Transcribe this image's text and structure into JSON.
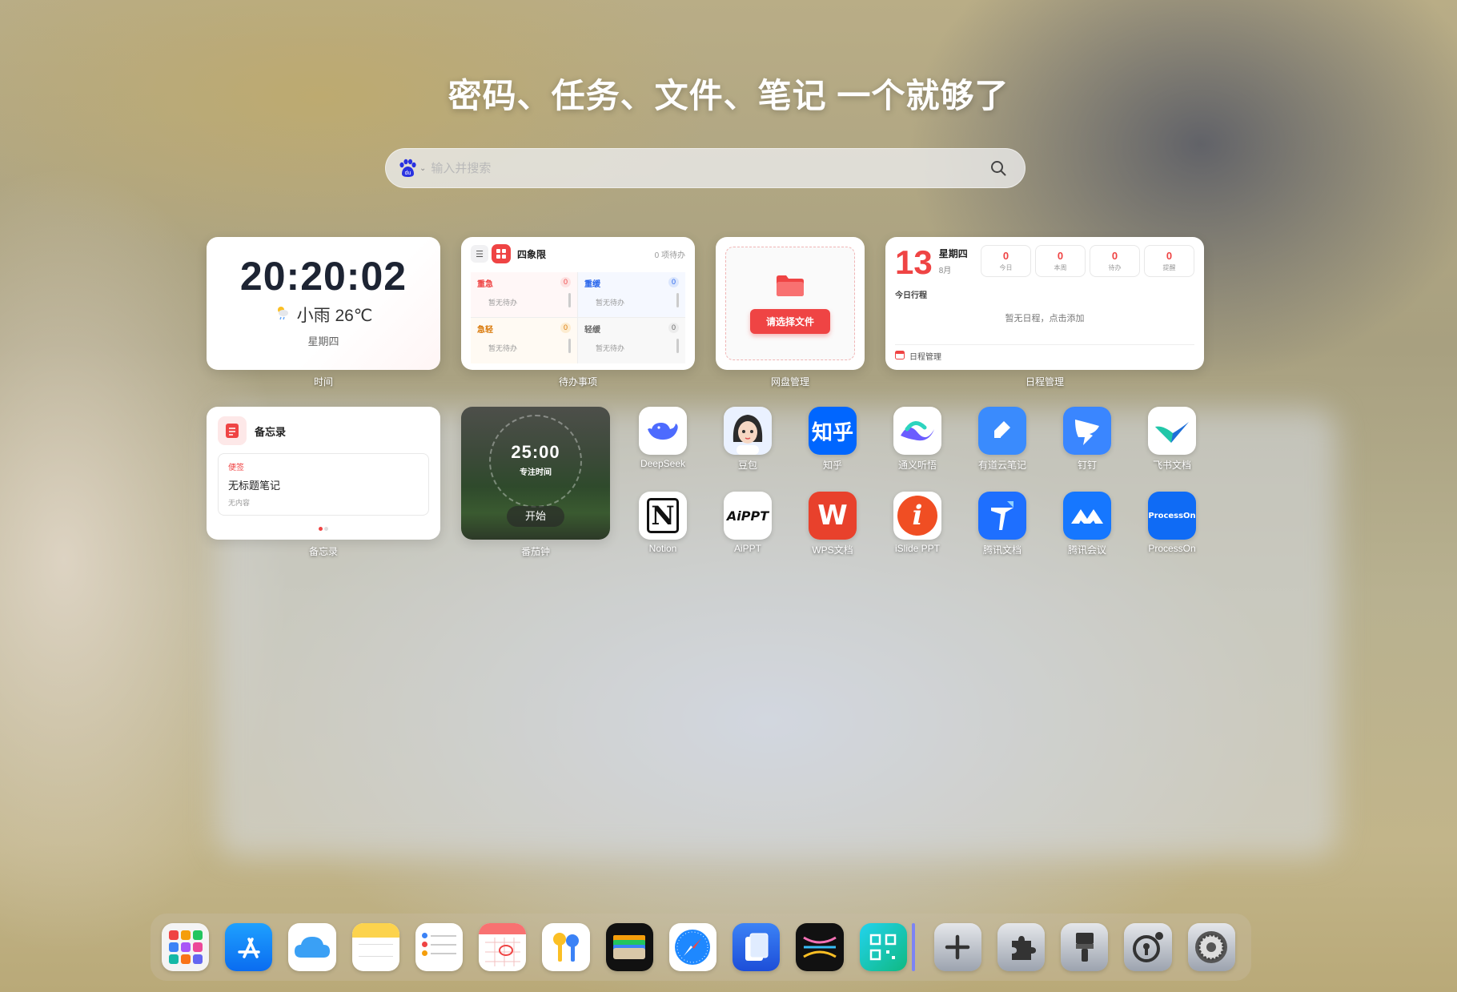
{
  "headline": "密码、任务、文件、笔记 一个就够了",
  "search": {
    "placeholder": "输入并搜索",
    "engine_icon": "baidu-paw-icon",
    "du": "du"
  },
  "widgets": {
    "time": {
      "clock": "20:20:02",
      "weather": "小雨 26℃",
      "weekday": "星期四",
      "caption": "时间"
    },
    "todo": {
      "title": "四象限",
      "count": "0 项待办",
      "caption": "待办事项",
      "quadrants": [
        {
          "label": "重急",
          "count": "0",
          "empty": "暂无待办",
          "color": "#ef4444",
          "badge_bg": "#fde2e2",
          "bg": "#fff7f7"
        },
        {
          "label": "重缓",
          "count": "0",
          "empty": "暂无待办",
          "color": "#2563eb",
          "badge_bg": "#dbe6fd",
          "bg": "#f5f8ff"
        },
        {
          "label": "急轻",
          "count": "0",
          "empty": "暂无待办",
          "color": "#d97706",
          "badge_bg": "#fdecd0",
          "bg": "#fffaf3"
        },
        {
          "label": "轻缓",
          "count": "0",
          "empty": "暂无待办",
          "color": "#666666",
          "badge_bg": "#ececec",
          "bg": "#f8f8f8"
        }
      ]
    },
    "disk": {
      "button": "请选择文件",
      "caption": "网盘管理"
    },
    "schedule": {
      "day": "13",
      "weekday": "星期四",
      "month": "8月",
      "stats": [
        {
          "value": "0",
          "label": "今日"
        },
        {
          "value": "0",
          "label": "本周"
        },
        {
          "value": "0",
          "label": "待办"
        },
        {
          "value": "0",
          "label": "提醒"
        }
      ],
      "today_label": "今日行程",
      "empty": "暂无日程，点击添加",
      "footer": "日程管理",
      "caption": "日程管理"
    },
    "memo": {
      "title": "备忘录",
      "tag": "便签",
      "note_title": "无标题笔记",
      "note_content": "无内容",
      "caption": "备忘录"
    },
    "pomodoro": {
      "time": "25:00",
      "label": "专注时间",
      "button": "开始",
      "caption": "番茄钟"
    }
  },
  "apps": [
    {
      "name": "DeepSeek",
      "icon": "deepseek-whale-icon"
    },
    {
      "name": "豆包",
      "icon": "doubao-avatar-icon"
    },
    {
      "name": "知乎",
      "icon": "zhihu-icon",
      "glyph": "知乎"
    },
    {
      "name": "通义听悟",
      "icon": "tongyi-tingwu-icon"
    },
    {
      "name": "有道云笔记",
      "icon": "youdao-note-icon"
    },
    {
      "name": "钉钉",
      "icon": "dingtalk-icon"
    },
    {
      "name": "飞书文档",
      "icon": "feishu-docs-icon"
    },
    {
      "name": "Notion",
      "icon": "notion-icon",
      "glyph": "N"
    },
    {
      "name": "AiPPT",
      "icon": "aippt-icon",
      "glyph": "AiPPT"
    },
    {
      "name": "WPS文档",
      "icon": "wps-icon",
      "glyph": "W"
    },
    {
      "name": "iSlide PPT",
      "icon": "islide-icon",
      "glyph": "i"
    },
    {
      "name": "腾讯文档",
      "icon": "tencent-docs-icon"
    },
    {
      "name": "腾讯会议",
      "icon": "tencent-meeting-icon"
    },
    {
      "name": "ProcessOn",
      "icon": "processon-icon",
      "glyph": "ProcessOn"
    }
  ],
  "dock": [
    "launchpad-icon",
    "app-store-icon",
    "icloud-icon",
    "notes-icon",
    "reminders-icon",
    "calendar-icon",
    "passwords-icon",
    "wallet-icon",
    "safari-icon",
    "files-icon",
    "mindmap-icon",
    "qr-code-icon",
    "add-icon",
    "extension-icon",
    "brush-icon",
    "password-lock-icon",
    "settings-icon"
  ]
}
